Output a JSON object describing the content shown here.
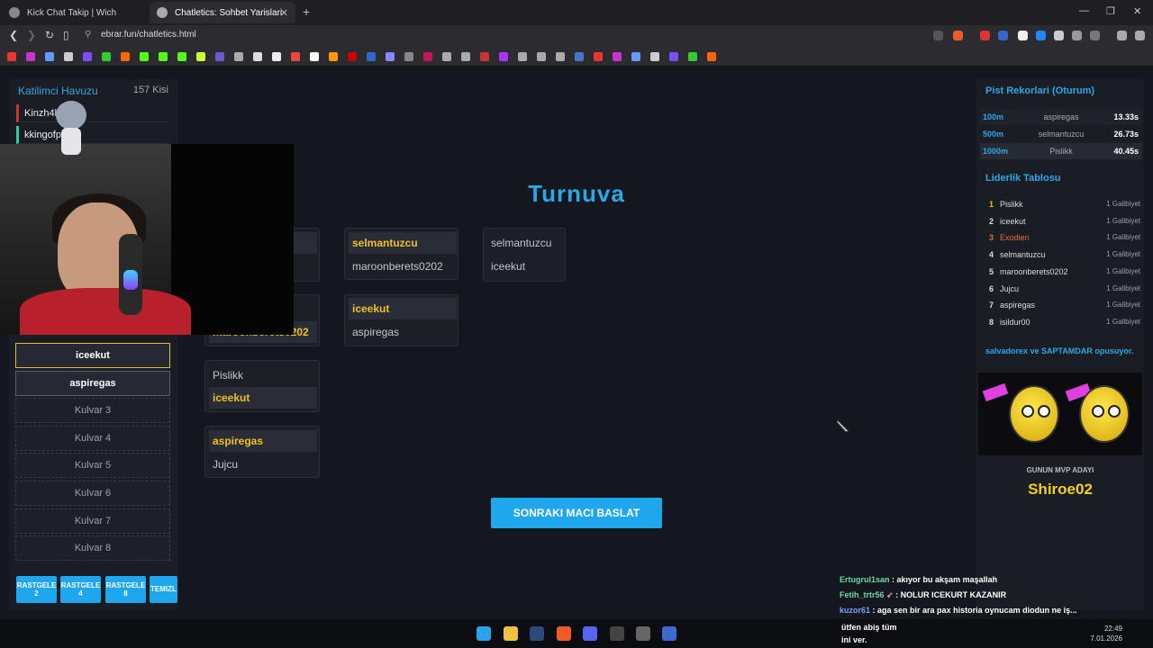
{
  "browser": {
    "tabs": [
      {
        "label": "Kick Chat Takip | Wich"
      },
      {
        "label": "Chatletics: Sohbet Yarislari"
      }
    ],
    "url": "ebrar.fun/chatletics.html"
  },
  "left_panel": {
    "title": "Katilimci Havuzu",
    "count": "157 Kisi",
    "participants": [
      "Kinzh4l",
      "kkingofpl"
    ],
    "lanes": [
      "iceekut",
      "aspiregas",
      "Kulvar 3",
      "Kulvar 4",
      "Kulvar 5",
      "Kulvar 6",
      "Kulvar 7",
      "Kulvar 8"
    ],
    "buttons": [
      {
        "line1": "RASTGELE",
        "line2": "2"
      },
      {
        "line1": "RASTGELE",
        "line2": "4"
      },
      {
        "line1": "RASTGELE",
        "line2": "8"
      },
      {
        "line1": "TEMIZL",
        "line2": ""
      }
    ]
  },
  "tournament": {
    "title": "Turnuva",
    "round1": [
      {
        "top": "",
        "bottom": ""
      },
      {
        "top": "",
        "bottom": "maroonberets0202"
      },
      {
        "top": "Pislikk",
        "bottom": "iceekut"
      },
      {
        "top": "aspiregas",
        "bottom": "Jujcu"
      }
    ],
    "round2": [
      {
        "top": "selmantuzcu",
        "bottom": "maroonberets0202"
      },
      {
        "top": "iceekut",
        "bottom": "aspiregas"
      }
    ],
    "round3": [
      {
        "top": "selmantuzcu",
        "bottom": "iceekut"
      }
    ],
    "start_button": "SONRAKI MACI BASLAT"
  },
  "right_panel": {
    "records_title": "Pist Rekorlari (Oturum)",
    "records": [
      {
        "distance": "100m",
        "name": "aspiregas",
        "time": "13.33s"
      },
      {
        "distance": "500m",
        "name": "selmantuzcu",
        "time": "26.73s"
      },
      {
        "distance": "1000m",
        "name": "Pislikk",
        "time": "40.45s"
      }
    ],
    "leaderboard_title": "Liderlik Tablosu",
    "leaderboard": [
      {
        "rank": "1",
        "name": "Pislikk",
        "wins": "1 Galibiyet"
      },
      {
        "rank": "2",
        "name": "iceekut",
        "wins": "1 Galibiyet"
      },
      {
        "rank": "3",
        "name": "Exodien",
        "wins": "1 Galibiyet"
      },
      {
        "rank": "4",
        "name": "selmantuzcu",
        "wins": "1 Galibiyet"
      },
      {
        "rank": "5",
        "name": "maroonberets0202",
        "wins": "1 Galibiyet"
      },
      {
        "rank": "6",
        "name": "Jujcu",
        "wins": "1 Galibiyet"
      },
      {
        "rank": "7",
        "name": "aspiregas",
        "wins": "1 Galibiyet"
      },
      {
        "rank": "8",
        "name": "isildur00",
        "wins": "1 Galibiyet"
      }
    ],
    "kiss_text": "salvadorex ve SAPTAMDAR opusuyor.",
    "mvp_label": "GUNUN MVP ADAYI",
    "mvp_name": "Shiroe02"
  },
  "chat": [
    {
      "user": "Ertugrul1san",
      "msg": ": akıyor bu akşam maşallah"
    },
    {
      "user": "Fetih_trtr56",
      "msg": ": NOLUR ICEKURT KAZANIR"
    },
    {
      "user": "kuzor61",
      "msg": ": aga sen bir ara pax historia oynucam diodun ne iş..."
    }
  ],
  "chat_leftover": [
    "ütfen abiş tüm",
    "ini ver."
  ],
  "taskbar": {
    "time": "22:49",
    "date": "7.01.2026"
  },
  "colors": {
    "accent": "#1ea7ef",
    "winner": "#f0c020",
    "panel": "#1b1d25"
  }
}
